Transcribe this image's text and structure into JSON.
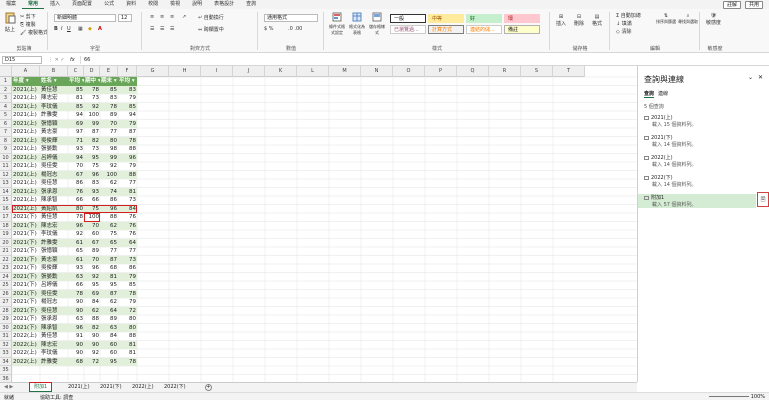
{
  "menu": {
    "items": [
      "檔案",
      "常用",
      "插入",
      "頁面配置",
      "公式",
      "資料",
      "校閱",
      "檢視",
      "說明",
      "表格設計",
      "查詢"
    ],
    "active": 1,
    "right": [
      "註解",
      "共用"
    ]
  },
  "ribbon": {
    "paste": "貼上",
    "cut": "剪下",
    "copy": "複製",
    "format_painter": "複製格式",
    "clipboard_label": "剪貼簿",
    "font_name": "新細明體",
    "font_size": "12",
    "font_label": "字型",
    "wrap_text": "自動換行",
    "merge_center": "跨欄置中",
    "align_label": "對齊方式",
    "number_format": "通用格式",
    "number_label": "數值",
    "cond_format": "條件式格式設定",
    "format_table": "格式化為表格",
    "cell_styles": "儲存格樣式",
    "style_label": "樣式",
    "styles": [
      {
        "label": "一般",
        "bg": "#ffffff",
        "fg": "#222222",
        "border": "#333333"
      },
      {
        "label": "中等",
        "bg": "#ffeb9c",
        "fg": "#9c5700",
        "border": "#ffeb9c"
      },
      {
        "label": "好",
        "bg": "#c6efce",
        "fg": "#006100",
        "border": "#c6efce"
      },
      {
        "label": "壞",
        "bg": "#ffc7ce",
        "fg": "#9c0006",
        "border": "#ffc7ce"
      },
      {
        "label": "已瀏覽過...",
        "bg": "#ffffff",
        "fg": "#954f72",
        "border": "#cccccc"
      },
      {
        "label": "計算方式",
        "bg": "#f2f2f2",
        "fg": "#fa7d00",
        "border": "#7f7f7f"
      },
      {
        "label": "連結的儲...",
        "bg": "#ffffff",
        "fg": "#fa7d00",
        "border": "#cccccc"
      },
      {
        "label": "備註",
        "bg": "#ffffcc",
        "fg": "#222222",
        "border": "#b2b2b2"
      }
    ],
    "insert": "插入",
    "delete": "刪除",
    "format": "格式",
    "cells_label": "儲存格",
    "autosum": "自動加總",
    "fill": "填滿",
    "clear": "清除",
    "sort_filter": "排序與篩選",
    "find_select": "尋找與選取",
    "edit_label": "編輯",
    "sensitivity": "敏感度",
    "sensitivity_label": "敏感度"
  },
  "formula_bar": {
    "name_box": "D15",
    "fx": "fx",
    "content": "66"
  },
  "columns": [
    "A",
    "B",
    "C",
    "D",
    "E",
    "F",
    "G",
    "H",
    "I",
    "J",
    "K",
    "L",
    "M",
    "N",
    "O",
    "P",
    "Q",
    "R",
    "S",
    "T"
  ],
  "table": {
    "headers": [
      "年度",
      "姓名",
      "平均",
      "期中",
      "期末",
      "平均"
    ],
    "rows": [
      [
        "2021(上)",
        "黃佳慧",
        "85",
        "78",
        "85",
        "83"
      ],
      [
        "2021(上)",
        "陳志宏",
        "81",
        "73",
        "83",
        "79"
      ],
      [
        "2021(上)",
        "李玟儀",
        "85",
        "92",
        "78",
        "85"
      ],
      [
        "2021(上)",
        "許雅雯",
        "94",
        "100",
        "89",
        "94"
      ],
      [
        "2021(上)",
        "張憶穎",
        "69",
        "99",
        "70",
        "79"
      ],
      [
        "2021(上)",
        "黃志豪",
        "97",
        "87",
        "77",
        "87"
      ],
      [
        "2021(上)",
        "吳俊輝",
        "71",
        "82",
        "80",
        "78"
      ],
      [
        "2021(上)",
        "張晏勳",
        "93",
        "73",
        "98",
        "88"
      ],
      [
        "2021(上)",
        "呂婷儀",
        "94",
        "95",
        "99",
        "96"
      ],
      [
        "2021(上)",
        "吳佳雯",
        "70",
        "75",
        "92",
        "79"
      ],
      [
        "2021(上)",
        "楊冠志",
        "67",
        "96",
        "100",
        "88"
      ],
      [
        "2021(上)",
        "吳佳慧",
        "86",
        "83",
        "62",
        "77"
      ],
      [
        "2021(上)",
        "張承恩",
        "76",
        "93",
        "74",
        "81"
      ],
      [
        "2021(上)",
        "陳承智",
        "66",
        "66",
        "86",
        "73"
      ],
      [
        "2021(上)",
        "黃紹凱",
        "80",
        "75",
        "96",
        "84"
      ],
      [
        "2021(下)",
        "黃佳慧",
        "78",
        "100",
        "88",
        "76"
      ],
      [
        "2021(下)",
        "陳志宏",
        "96",
        "70",
        "62",
        "76"
      ],
      [
        "2021(下)",
        "李玟儀",
        "92",
        "60",
        "75",
        "76"
      ],
      [
        "2021(下)",
        "許雅雯",
        "61",
        "67",
        "65",
        "64"
      ],
      [
        "2021(下)",
        "張憶穎",
        "65",
        "89",
        "77",
        "77"
      ],
      [
        "2021(下)",
        "黃志豪",
        "61",
        "70",
        "87",
        "73"
      ],
      [
        "2021(下)",
        "吳俊輝",
        "93",
        "96",
        "68",
        "86"
      ],
      [
        "2021(下)",
        "張晏勳",
        "63",
        "92",
        "81",
        "79"
      ],
      [
        "2021(下)",
        "呂婷儀",
        "66",
        "95",
        "95",
        "85"
      ],
      [
        "2021(下)",
        "吳佳雯",
        "78",
        "69",
        "87",
        "78"
      ],
      [
        "2021(下)",
        "楊冠志",
        "90",
        "84",
        "62",
        "79"
      ],
      [
        "2021(下)",
        "吳佳慧",
        "90",
        "62",
        "64",
        "72"
      ],
      [
        "2021(下)",
        "張承恩",
        "63",
        "88",
        "89",
        "80"
      ],
      [
        "2021(下)",
        "陳承智",
        "96",
        "82",
        "63",
        "80"
      ],
      [
        "2022(上)",
        "黃佳慧",
        "91",
        "90",
        "84",
        "88"
      ],
      [
        "2022(上)",
        "陳志宏",
        "90",
        "90",
        "60",
        "81"
      ],
      [
        "2022(上)",
        "李玟儀",
        "90",
        "92",
        "60",
        "81"
      ],
      [
        "2022(上)",
        "許雅雯",
        "68",
        "72",
        "95",
        "78"
      ]
    ]
  },
  "sheet_tabs": [
    "附加1",
    "2021(上)",
    "2021(下)",
    "2022(上)",
    "2022(下)"
  ],
  "active_sheet": 0,
  "status": {
    "ready": "就緒",
    "accessibility": "協助工具: 調查",
    "zoom": "100%"
  },
  "side_panel": {
    "title": "查詢與連線",
    "tabs": [
      "查詢",
      "連線"
    ],
    "count_label": "5 個查詢",
    "queries": [
      {
        "name": "2021(上)",
        "detail": "載入 15 個資料列。"
      },
      {
        "name": "2021(下)",
        "detail": "載入 14 個資料列。"
      },
      {
        "name": "2022(上)",
        "detail": "載入 14 個資料列。"
      },
      {
        "name": "2022(下)",
        "detail": "載入 14 個資料列。"
      },
      {
        "name": "附加1",
        "detail": "載入 57 個資料列。"
      }
    ]
  }
}
